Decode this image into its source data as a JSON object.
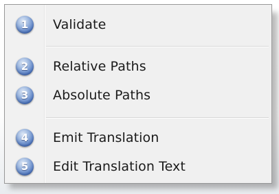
{
  "menu": {
    "items": [
      {
        "number": "1",
        "label": "Validate"
      },
      {
        "number": "2",
        "label": "Relative Paths"
      },
      {
        "number": "3",
        "label": "Absolute Paths"
      },
      {
        "number": "4",
        "label": "Emit Translation"
      },
      {
        "number": "5",
        "label": "Edit Translation Text"
      }
    ],
    "colors": {
      "background": "#f0f0f0",
      "border": "#979797",
      "badge": "#4f78c2",
      "text": "#1a1a1a"
    }
  }
}
